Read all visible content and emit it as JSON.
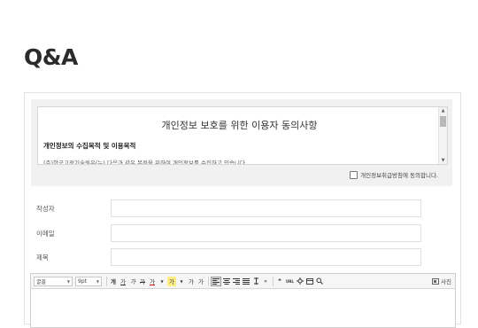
{
  "page": {
    "title": "Q&A"
  },
  "consent": {
    "title": "개인정보 보호를 위한 이용자 동의사항",
    "subtitle": "개인정보의 수집목적 및 이용목적",
    "body": "(주)한국고정기술원은(는) 다음과 같은 목적을 위하여 개인정보를 수집하고 있습니다 .",
    "agree_label": "개인정보취급방침에 동의합니다."
  },
  "fields": [
    {
      "label": "작성자",
      "value": ""
    },
    {
      "label": "이메일",
      "value": ""
    },
    {
      "label": "제목",
      "value": ""
    }
  ],
  "toolbar": {
    "font_select": "굴꼴",
    "size_select": "9pt",
    "bold": "개",
    "underline": "가",
    "italic": "가",
    "strike": "가",
    "text_color": "가",
    "bg_color": "가",
    "superscript": "가",
    "subscript": "가",
    "quote": "❝",
    "url": "URL",
    "photo_label": "사진"
  }
}
